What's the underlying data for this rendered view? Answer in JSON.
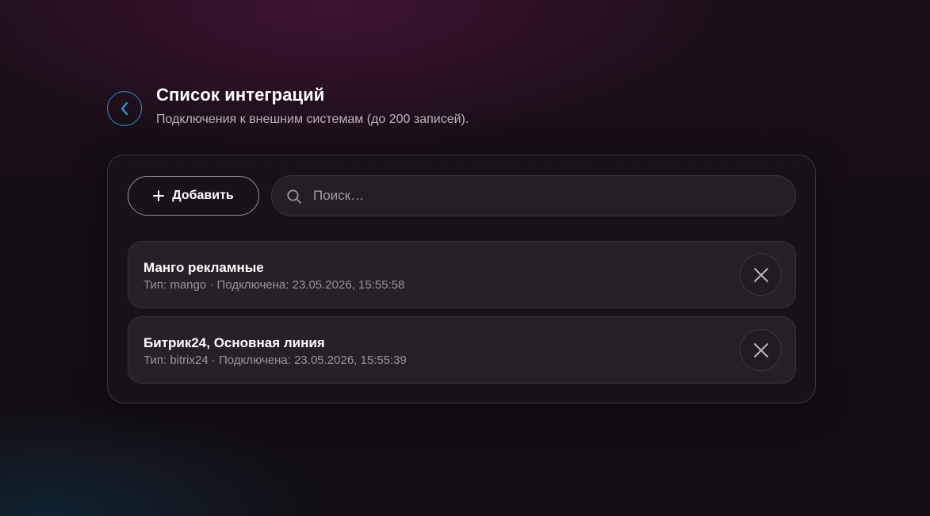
{
  "header": {
    "back_icon": "chevron-left-icon",
    "title": "Список интеграций",
    "subtitle": "Подключения к внешним системам (до 200 записей)."
  },
  "toolbar": {
    "add_label": "Добавить",
    "add_icon": "plus-icon",
    "search_icon": "search-icon",
    "search_placeholder": "Поиск…",
    "search_value": ""
  },
  "integrations": [
    {
      "name": "Манго рекламные",
      "meta": "Тип: mango · Подключена: 23.05.2026, 15:55:58",
      "remove_icon": "close-icon"
    },
    {
      "name": "Битрик24, Основная линия",
      "meta": "Тип: bitrix24 · Подключена: 23.05.2026, 15:55:39",
      "remove_icon": "close-icon"
    }
  ],
  "colors": {
    "accent": "#2a8fd0",
    "text_primary": "#ffffff",
    "text_secondary": "#9a939d"
  }
}
